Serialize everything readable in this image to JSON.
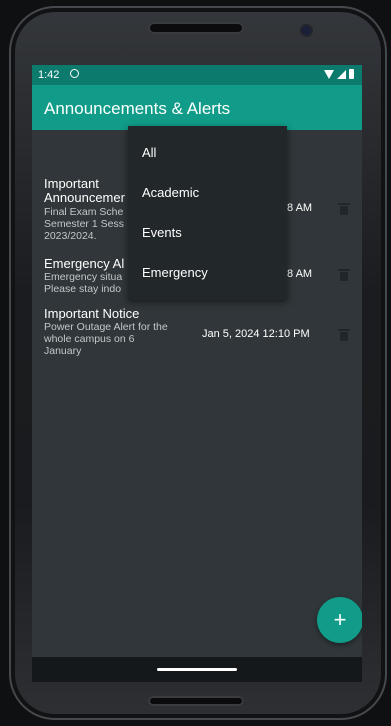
{
  "status_bar": {
    "time": "1:42",
    "icons": [
      "app-notification-icon",
      "wifi-icon",
      "signal-icon",
      "battery-icon"
    ]
  },
  "app_bar": {
    "title": "Announcements & Alerts"
  },
  "filter_menu": {
    "options": [
      "All",
      "Academic",
      "Events",
      "Emergency"
    ]
  },
  "announcements": [
    {
      "title": "Important\nAnnouncemer",
      "description": "Final Exam Sche\nSemester 1 Sess\n2023/2024.",
      "date": "8 AM",
      "delete_icon": "trash-icon"
    },
    {
      "title": "Emergency Al",
      "description": "Emergency situa\nPlease stay indo",
      "date": "8 AM",
      "delete_icon": "trash-icon"
    },
    {
      "title": "Important Notice",
      "description": "Power Outage Alert for the\nwhole campus on 6\nJanuary",
      "date": "Jan 5, 2024 12:10 PM",
      "delete_icon": "trash-icon"
    }
  ],
  "fab": {
    "label": "+",
    "icon": "plus-icon"
  },
  "colors": {
    "primary": "#109c88",
    "status_bar": "#0c7a6c",
    "background": "#303639",
    "menu_background": "#22272a"
  }
}
